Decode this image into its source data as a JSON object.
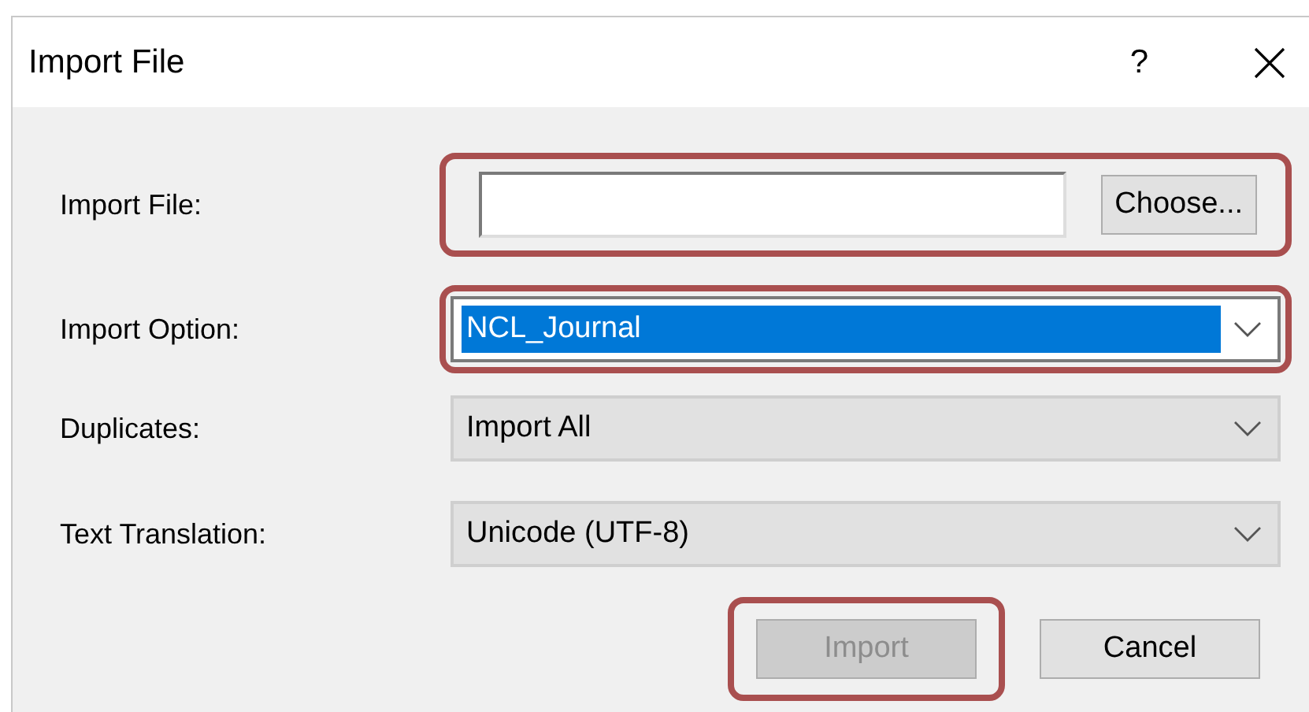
{
  "window": {
    "title": "Import File",
    "help": "?"
  },
  "fields": [
    {
      "label": "Import File:",
      "kind": "file",
      "button": "Choose...",
      "highlighted": true
    },
    {
      "label": "Import Option:",
      "kind": "select",
      "value": "NCL_Journal",
      "focused": true,
      "highlighted": true
    },
    {
      "label": "Duplicates:",
      "kind": "select",
      "value": "Import All",
      "focused": false,
      "highlighted": false
    },
    {
      "label": "Text Translation:",
      "kind": "select",
      "value": "Unicode (UTF-8)",
      "focused": false,
      "highlighted": false
    }
  ],
  "buttons": [
    {
      "label": "Import",
      "disabled": true,
      "highlighted": true
    },
    {
      "label": "Cancel",
      "disabled": false,
      "highlighted": false
    }
  ]
}
